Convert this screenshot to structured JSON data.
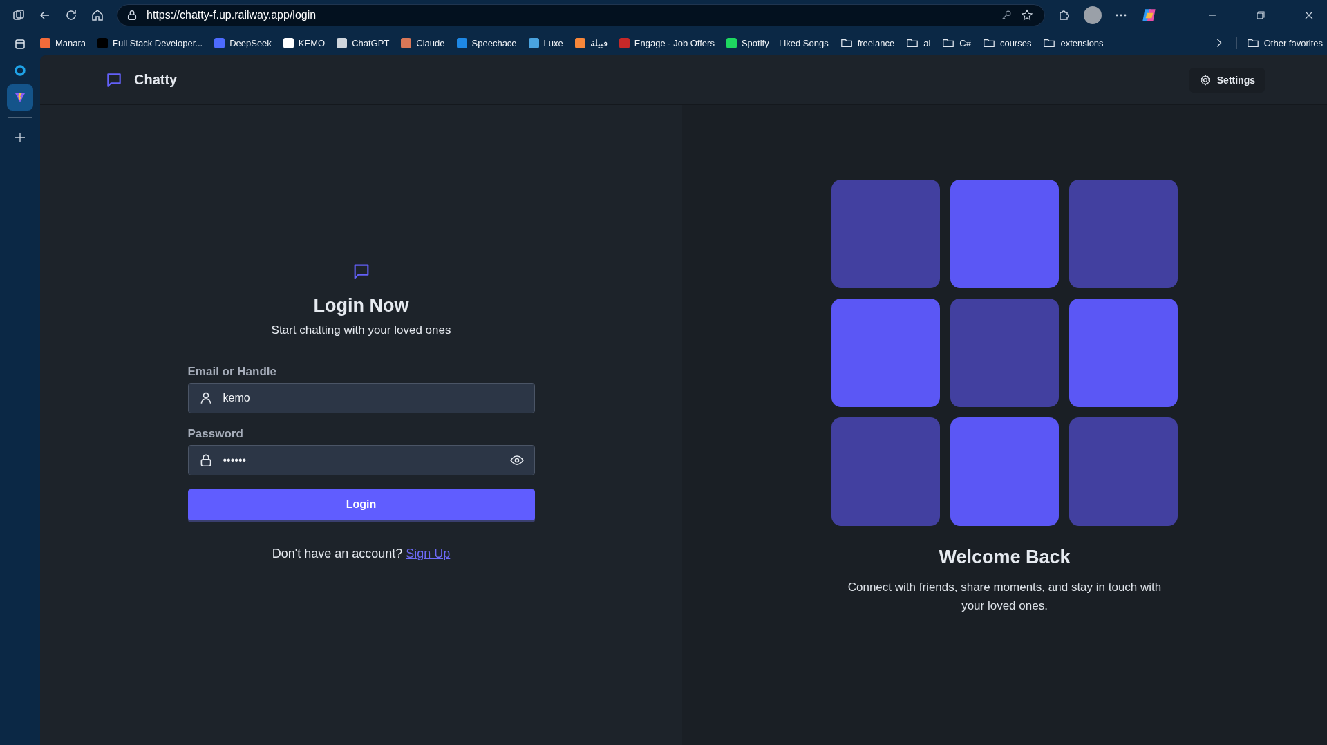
{
  "browser": {
    "url": "https://chatty-f.up.railway.app/login",
    "bookmarks": [
      {
        "kind": "site",
        "label": "Manara",
        "color": "#f26b3a"
      },
      {
        "kind": "site",
        "label": "Full Stack Developer...",
        "color": "#000000"
      },
      {
        "kind": "site",
        "label": "DeepSeek",
        "color": "#4d6bfe"
      },
      {
        "kind": "site",
        "label": "KEMO",
        "color": "#ffffff"
      },
      {
        "kind": "site",
        "label": "ChatGPT",
        "color": "#cfd6dd"
      },
      {
        "kind": "site",
        "label": "Claude",
        "color": "#d97757"
      },
      {
        "kind": "site",
        "label": "Speechace",
        "color": "#1e88e5"
      },
      {
        "kind": "site",
        "label": "Luxe",
        "color": "#4aa3df"
      },
      {
        "kind": "site",
        "label": "قبيلة",
        "color": "#f7873a"
      },
      {
        "kind": "site",
        "label": "Engage - Job Offers",
        "color": "#c62828"
      },
      {
        "kind": "site",
        "label": "Spotify – Liked Songs",
        "color": "#1ed760"
      },
      {
        "kind": "folder",
        "label": "freelance"
      },
      {
        "kind": "folder",
        "label": "ai"
      },
      {
        "kind": "folder",
        "label": "C#"
      },
      {
        "kind": "folder",
        "label": "courses"
      },
      {
        "kind": "folder",
        "label": "extensions"
      }
    ],
    "other_favorites": "Other favorites"
  },
  "app": {
    "brand": "Chatty",
    "settings": "Settings"
  },
  "login": {
    "title": "Login Now",
    "subtitle": "Start chatting with your loved ones",
    "email": {
      "label": "Email or Handle",
      "value": "kemo"
    },
    "password": {
      "label": "Password",
      "value": "••••••"
    },
    "button": "Login",
    "prompt": "Don't have an account?",
    "link": "Sign Up"
  },
  "welcome": {
    "tiles": [
      {
        "lit": false
      },
      {
        "lit": true
      },
      {
        "lit": false
      },
      {
        "lit": true
      },
      {
        "lit": false
      },
      {
        "lit": true
      },
      {
        "lit": false
      },
      {
        "lit": true
      },
      {
        "lit": false
      }
    ],
    "title": "Welcome Back",
    "text": "Connect with friends, share moments, and stay in touch with your loved ones."
  }
}
